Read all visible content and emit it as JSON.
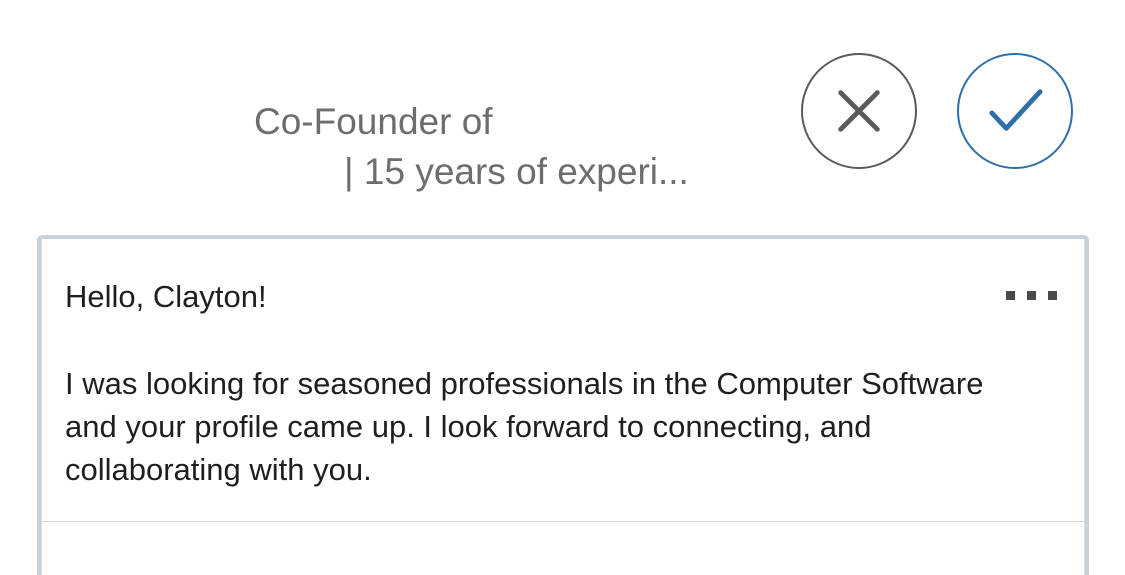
{
  "invitation": {
    "headline_line1": "Co-Founder of",
    "headline_line2": "| 15 years of experi..."
  },
  "actions": {
    "ignore_icon": "close-x-icon",
    "accept_icon": "checkmark-icon",
    "ignore_color": "#5a5a5a",
    "accept_color": "#2f6fa8"
  },
  "message": {
    "greeting": "Hello, Clayton!",
    "body": "I was looking for seasoned professionals in the Computer Software and your profile came up. I look forward to connecting, and collaborating with you.",
    "more_icon": "more-options-icon"
  },
  "colors": {
    "card_border": "#c9d2d9",
    "muted_text": "#6d6d6d",
    "body_text": "#1f1f1f"
  }
}
